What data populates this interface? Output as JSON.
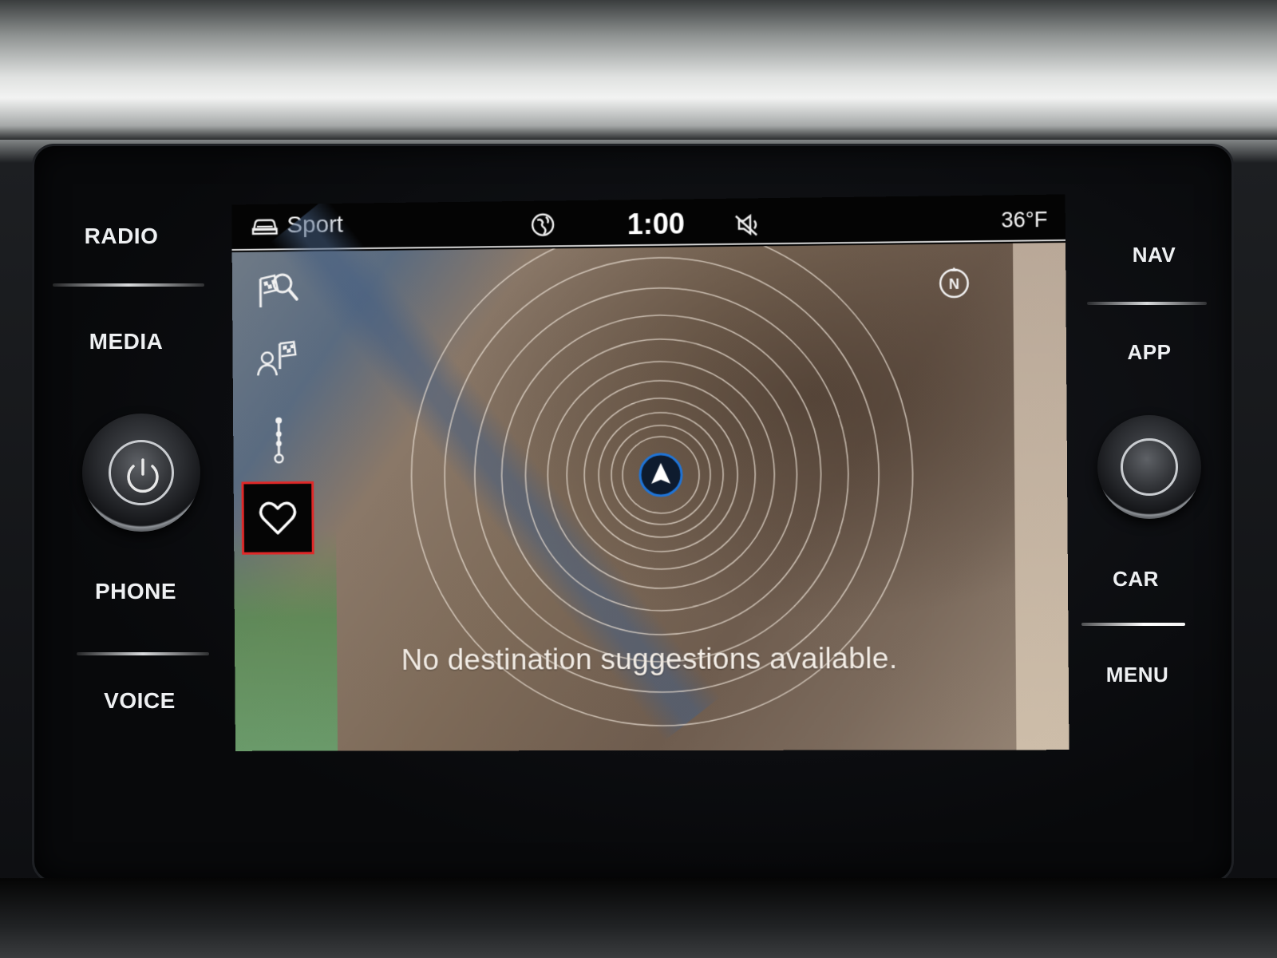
{
  "hardware_buttons": {
    "left": {
      "radio": "RADIO",
      "media": "MEDIA",
      "phone": "PHONE",
      "voice": "VOICE"
    },
    "right": {
      "nav": "NAV",
      "app": "APP",
      "car": "CAR",
      "menu": "MENU"
    }
  },
  "status_bar": {
    "drive_mode": "Sport",
    "time": "1:00",
    "temperature": "36°F",
    "drive_mode_icon": "car-profile-icon",
    "globe_icon": "globe-icon",
    "sound_icon": "speaker-muted-icon"
  },
  "sidebar": {
    "items": [
      {
        "name": "destination-search",
        "icon": "flag-search-icon",
        "selected": false
      },
      {
        "name": "contacts-destination",
        "icon": "person-flag-icon",
        "selected": false
      },
      {
        "name": "route",
        "icon": "route-stops-icon",
        "selected": false
      },
      {
        "name": "favorites",
        "icon": "heart-icon",
        "selected": true
      }
    ]
  },
  "map": {
    "message": "No destination suggestions available.",
    "compass_label": "N",
    "accent_color": "#1e74d8",
    "selection_color": "#e02828"
  }
}
